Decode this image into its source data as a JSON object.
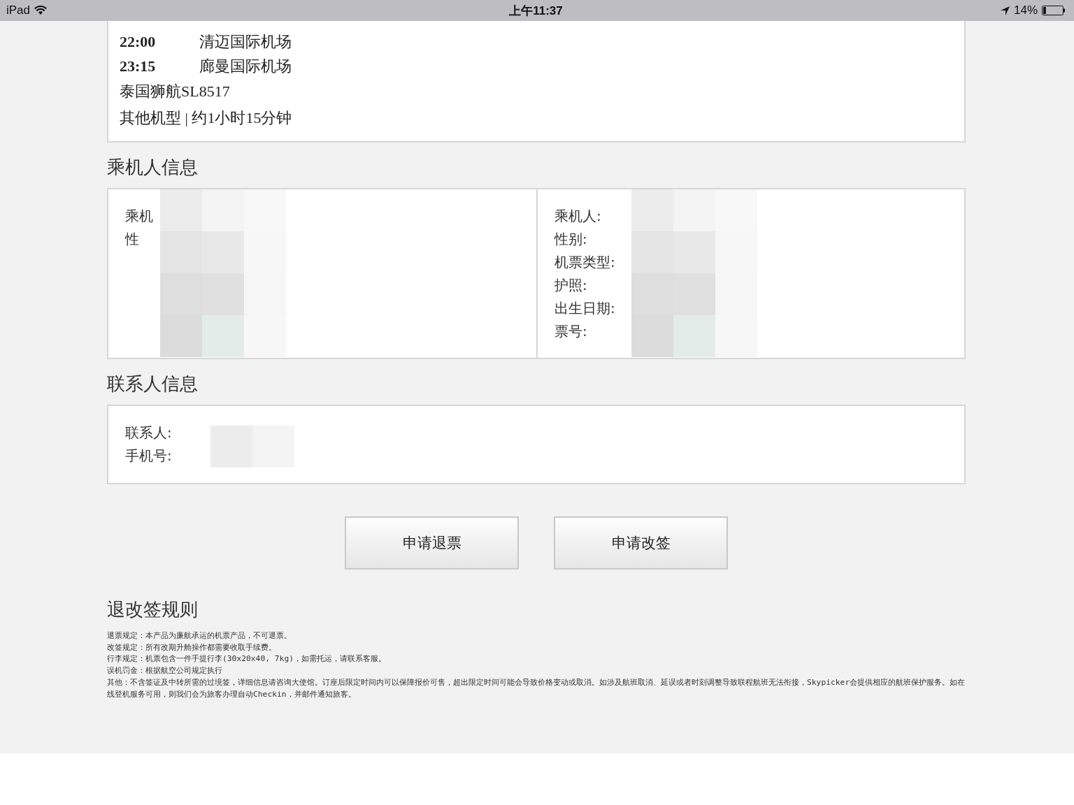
{
  "status_bar": {
    "device": "iPad",
    "time": "上午11:37",
    "battery_text": "14%",
    "battery": {
      "level": 0.14
    }
  },
  "flight": {
    "legs": [
      {
        "time": "22:00",
        "airport": "清迈国际机场"
      },
      {
        "time": "23:15",
        "airport": "廊曼国际机场"
      }
    ],
    "flight_no": "泰国狮航SL8517",
    "details": "其他机型 | 约1小时15分钟"
  },
  "passenger_section": {
    "title": "乘机人信息",
    "columns": [
      {
        "labels": [
          "乘机",
          "性"
        ]
      },
      {
        "labels": [
          "乘机人:",
          "性别:",
          "机票类型:",
          "护照:",
          "出生日期:",
          "票号:"
        ]
      }
    ]
  },
  "contact_section": {
    "title": "联系人信息",
    "labels": [
      "联系人:",
      "手机号:"
    ]
  },
  "buttons": [
    "申请退票",
    "申请改签"
  ],
  "rules": {
    "title": "退改签规则",
    "lines": [
      "退票规定：本产品为廉航承运的机票产品，不可退票。",
      "改签规定：所有改期升舱操作都需要收取手续费。",
      "行李规定：机票包含一件手提行李(30x20x40, 7kg)，如需托运，请联系客服。",
      "误机罚金：根据航空公司规定执行",
      "其他：不含签证及中转所需的过境签，详细信息请咨询大使馆。订座后限定时间内可以保障报价可售，超出限定时间可能会导致价格变动或取消。如涉及航班取消、延误或者时刻调整导致联程航班无法衔接，Skypicker会提供相应的航班保护服务。如在线登机服务可用，则我们会为旅客办理自动Checkin，并邮件通知旅客。"
    ]
  }
}
